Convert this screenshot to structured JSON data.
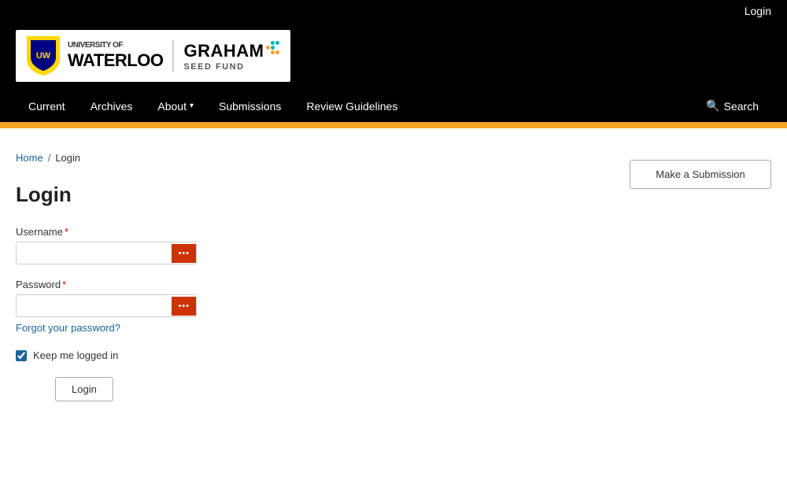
{
  "topbar": {
    "login_label": "Login"
  },
  "logo": {
    "university_of": "UNIVERSITY OF",
    "waterloo": "WATERLOO",
    "graham": "GRAHAM",
    "seed_fund": "SEED FUND"
  },
  "nav": {
    "items": [
      {
        "id": "current",
        "label": "Current"
      },
      {
        "id": "archives",
        "label": "Archives"
      },
      {
        "id": "about",
        "label": "About"
      },
      {
        "id": "submissions",
        "label": "Submissions"
      },
      {
        "id": "review-guidelines",
        "label": "Review Guidelines"
      }
    ],
    "search_label": "Search"
  },
  "breadcrumb": {
    "home_label": "Home",
    "separator": "/",
    "current": "Login"
  },
  "form": {
    "title": "Login",
    "username_label": "Username",
    "username_required": "*",
    "password_label": "Password",
    "password_required": "*",
    "forgot_label": "Forgot your password?",
    "keep_logged_in_label": "Keep me logged in",
    "login_button_label": "Login"
  },
  "sidebar": {
    "make_submission_label": "Make a Submission"
  }
}
